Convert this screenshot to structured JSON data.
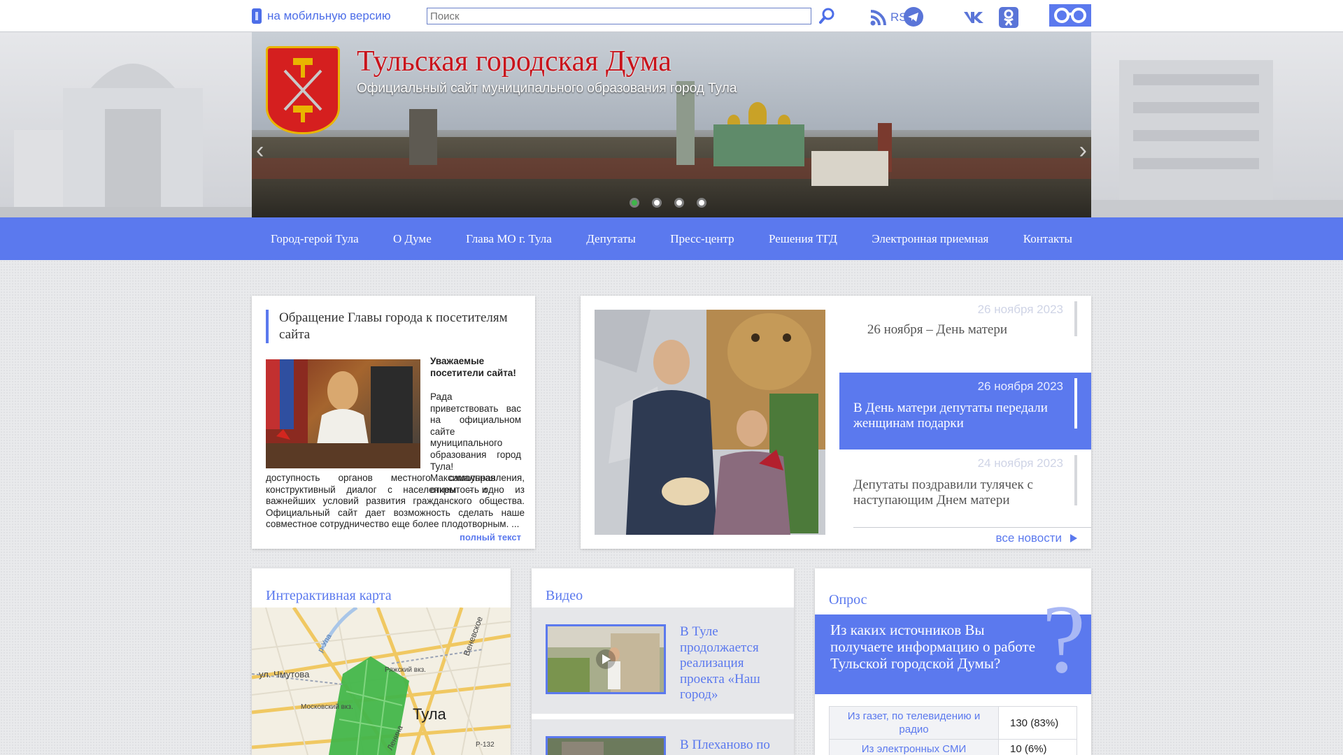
{
  "topbar": {
    "mobile_label": "на мобильную версию",
    "search_placeholder": "Поиск",
    "rss_label": "RSS"
  },
  "header": {
    "title": "Тульская городская Дума",
    "subtitle": "Официальный сайт муниципального образования город Тула",
    "slides_total": 4,
    "slide_active": 1
  },
  "nav": {
    "items": [
      "Город-герой Тула",
      "О Думе",
      "Глава МО г. Тула",
      "Депутаты",
      "Пресс-центр",
      "Решения ТГД",
      "Электронная приемная",
      "Контакты"
    ]
  },
  "appeal": {
    "title": "Обращение Главы города к посетителям сайта",
    "greeting": "Уважаемые посетители сайта!",
    "body_a": "Рада приветствовать вас на официальном сайте муниципального образования город Тула! Максимальная открытость и",
    "body_b": "доступность органов местного самоуправления, конструктивный диалог с населением – одно из важнейших условий развития гражданского общества. Официальный сайт дает возможность сделать наше совместное сотрудничество еще более плодотворным. ...",
    "full_text_link": "полный текст"
  },
  "news": {
    "items": [
      {
        "date": "26 ноября 2023",
        "title": "26 ноября – День матери",
        "active": false
      },
      {
        "date": "26 ноября 2023",
        "title": "В День матери депутаты передали женщинам подарки",
        "active": true
      },
      {
        "date": "24 ноября 2023",
        "title": "Депутаты поздравили тулячек с наступающим Днем матери",
        "active": false
      }
    ],
    "all_news_label": "все новости"
  },
  "map_block": {
    "heading": "Интерактивная карта",
    "labels": {
      "city": "Тула",
      "street1": "ул. Чмутова",
      "station1": "Московский вкз.",
      "station2": "Ряжский вкз.",
      "street2": "Веневское",
      "street3": "р-Упа",
      "road": "Р-132",
      "street4": "Ленина"
    }
  },
  "video": {
    "heading": "Видео",
    "items": [
      {
        "title": "В Туле продолжается реализация проекта «Наш город»"
      },
      {
        "title": "В Плеханово по"
      }
    ]
  },
  "poll": {
    "heading": "Опрос",
    "question": "Из каких источников Вы получаете информацию о работе Тульской городской Думы?",
    "question_mark": "?",
    "options": [
      {
        "label": "Из газет, по телевидению и радио",
        "result": "130 (83%)",
        "share": 0.83
      },
      {
        "label": "Из электронных СМИ",
        "result": "10 (6%)",
        "share": 0.06
      }
    ]
  },
  "colors": {
    "accent": "#5b79ee",
    "title_red": "#c8141c",
    "active_dot": "#3fb54a"
  }
}
